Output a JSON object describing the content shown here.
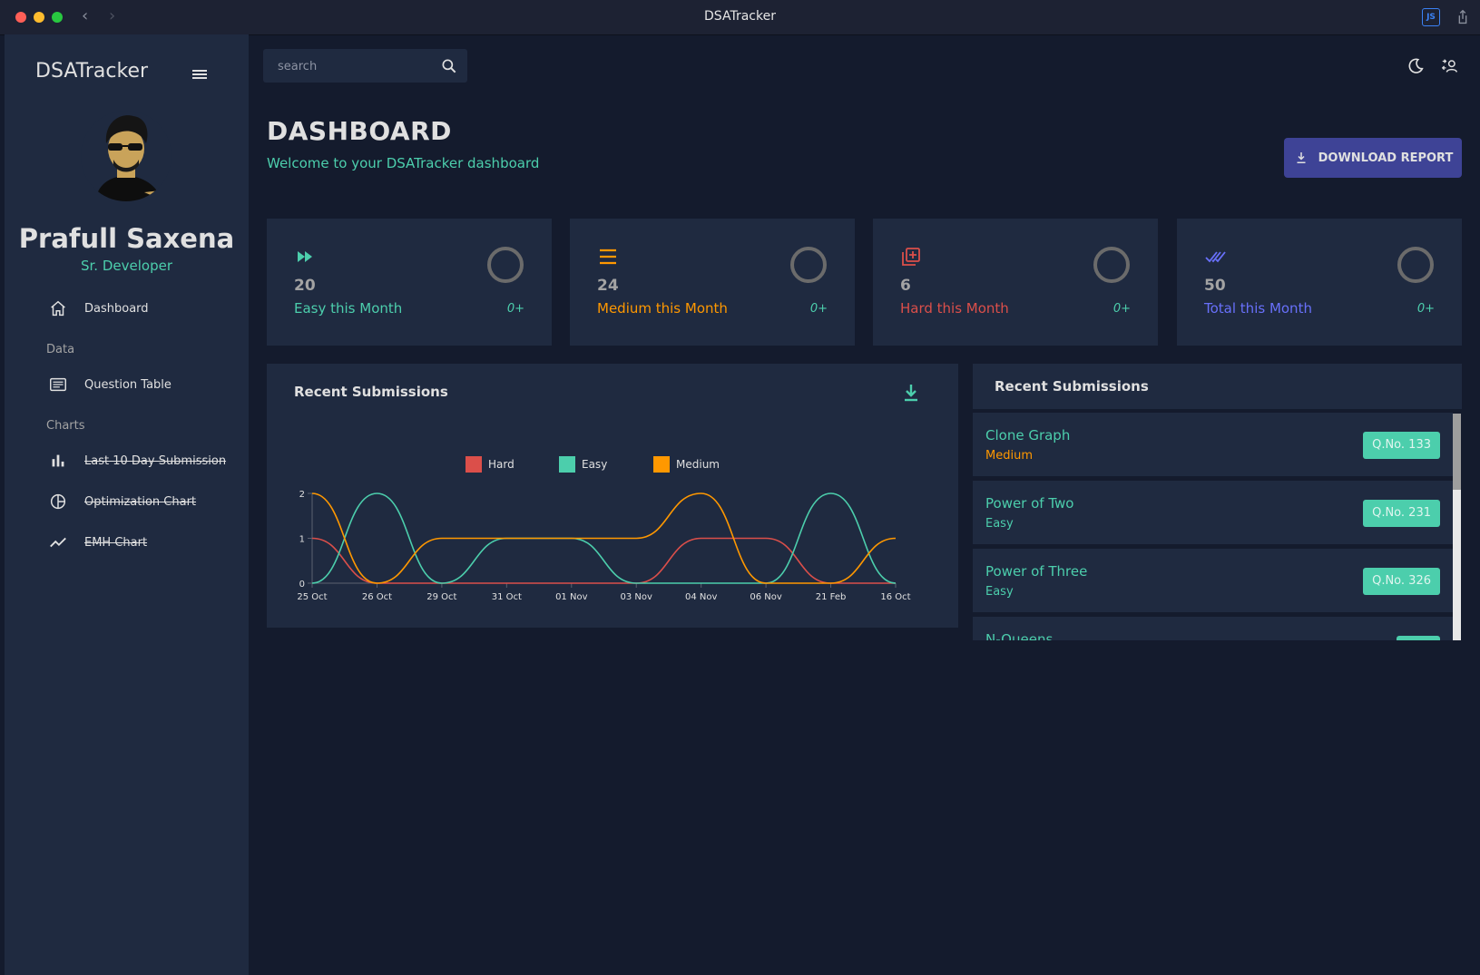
{
  "window": {
    "title": "DSATracker",
    "ext_badge": "JS"
  },
  "sidebar": {
    "brand": "DSATracker",
    "profile": {
      "name": "Prafull Saxena",
      "role": "Sr. Developer"
    },
    "items": [
      {
        "label": "Dashboard",
        "icon": "home-icon"
      },
      {
        "label": "Question Table",
        "icon": "receipt-icon"
      },
      {
        "label": "Last 10 Day Submission",
        "icon": "bar-chart-icon"
      },
      {
        "label": "Optimization Chart",
        "icon": "pie-chart-icon"
      },
      {
        "label": "EMH Chart",
        "icon": "timeline-icon"
      }
    ],
    "sections": {
      "data": "Data",
      "charts": "Charts"
    }
  },
  "topbar": {
    "search_placeholder": "search"
  },
  "header": {
    "title": "DASHBOARD",
    "subtitle": "Welcome to your DSATracker dashboard",
    "download_label": "DOWNLOAD REPORT"
  },
  "stats": [
    {
      "value": "20",
      "label": "Easy this Month",
      "increase": "0+",
      "color": "#4cceac",
      "icon": "fast-forward-icon"
    },
    {
      "value": "24",
      "label": "Medium this Month",
      "increase": "0+",
      "color": "#ff9800",
      "icon": "list-icon"
    },
    {
      "value": "6",
      "label": "Hard this Month",
      "increase": "0+",
      "color": "#db4f4a",
      "icon": "library-add-icon"
    },
    {
      "value": "50",
      "label": "Total this Month",
      "increase": "0+",
      "color": "#6870fa",
      "icon": "done-all-icon"
    }
  ],
  "chart_panel": {
    "title": "Recent Submissions"
  },
  "chart_data": {
    "type": "line",
    "categories": [
      "25 Oct",
      "26 Oct",
      "29 Oct",
      "31 Oct",
      "01 Nov",
      "03 Nov",
      "04 Nov",
      "06 Nov",
      "21 Feb",
      "16 Oct"
    ],
    "series": [
      {
        "name": "Hard",
        "color": "#db4f4a",
        "values": [
          1,
          0,
          0,
          0,
          0,
          0,
          1,
          1,
          0,
          0
        ]
      },
      {
        "name": "Easy",
        "color": "#4cceac",
        "values": [
          0,
          2,
          0,
          1,
          1,
          0,
          0,
          0,
          2,
          0
        ]
      },
      {
        "name": "Medium",
        "color": "#ff9800",
        "values": [
          2,
          0,
          1,
          1,
          1,
          1,
          2,
          0,
          0,
          1
        ]
      }
    ],
    "yticks": [
      "0",
      "1",
      "2"
    ],
    "ylim": [
      0,
      2
    ],
    "legend": "top-center",
    "grid": false
  },
  "submissions": {
    "title": "Recent Submissions",
    "items": [
      {
        "name": "Clone Graph",
        "difficulty": "Medium",
        "difficulty_color": "#ff9800",
        "qno": "Q.No. 133"
      },
      {
        "name": "Power of Two",
        "difficulty": "Easy",
        "difficulty_color": "#4cceac",
        "qno": "Q.No. 231"
      },
      {
        "name": "Power of Three",
        "difficulty": "Easy",
        "difficulty_color": "#4cceac",
        "qno": "Q.No. 326"
      },
      {
        "name": "N-Queens",
        "difficulty": "",
        "difficulty_color": "#4cceac",
        "qno": ""
      }
    ]
  },
  "colors": {
    "accent": "#4cceac",
    "primary": "#141b2d",
    "panel": "#1f2a40",
    "button": "#3e4396"
  }
}
